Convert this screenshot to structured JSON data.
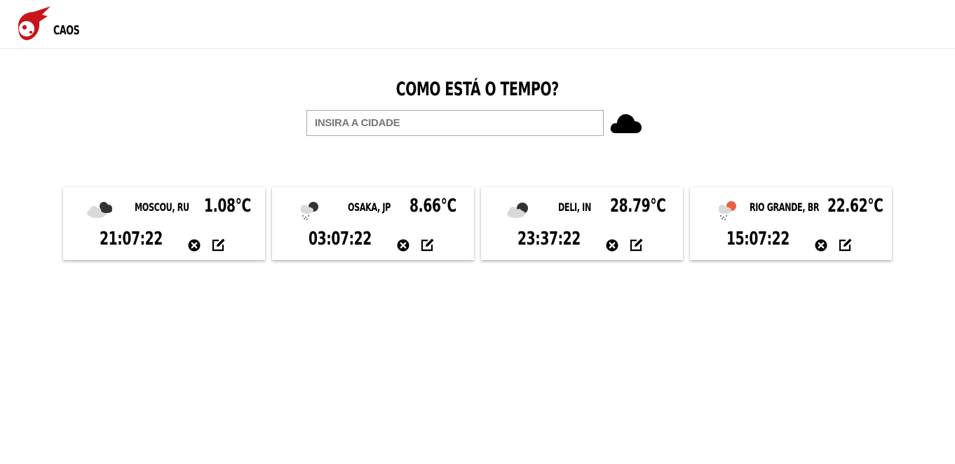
{
  "header": {
    "brand": "CAOS",
    "logo_icon": "meteor-logo-icon",
    "brand_color": "#c8151b"
  },
  "search": {
    "title": "COMO ESTÁ O TEMPO?",
    "placeholder": "INSIRA A CIDADE",
    "value": "",
    "button_icon": "cloud-icon"
  },
  "cards": [
    {
      "city": "MOSCOU, RU",
      "temp": "1.08°C",
      "time": "21:07:22",
      "weather_icon": "broken-clouds-icon"
    },
    {
      "city": "OSAKA, JP",
      "temp": "8.66°C",
      "time": "03:07:22",
      "weather_icon": "night-rain-icon"
    },
    {
      "city": "DELI, IN",
      "temp": "28.79°C",
      "time": "23:37:22",
      "weather_icon": "night-cloudy-icon"
    },
    {
      "city": "RIO GRANDE, BR",
      "temp": "22.62°C",
      "time": "15:07:22",
      "weather_icon": "day-rain-icon"
    }
  ],
  "card_actions": {
    "delete_icon": "close-circle-icon",
    "edit_icon": "edit-icon"
  }
}
